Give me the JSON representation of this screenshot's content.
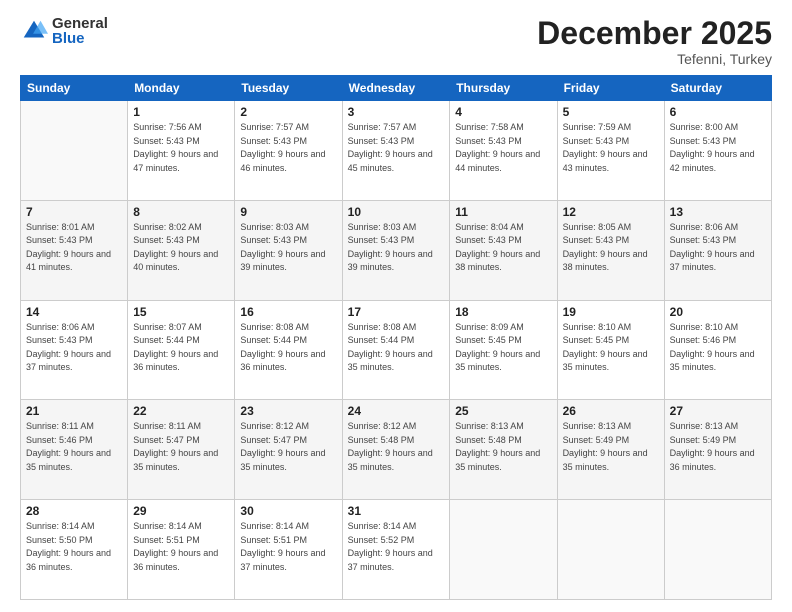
{
  "logo": {
    "general": "General",
    "blue": "Blue"
  },
  "header": {
    "month": "December 2025",
    "location": "Tefenni, Turkey"
  },
  "days_of_week": [
    "Sunday",
    "Monday",
    "Tuesday",
    "Wednesday",
    "Thursday",
    "Friday",
    "Saturday"
  ],
  "weeks": [
    [
      {
        "day": "",
        "sunrise": "",
        "sunset": "",
        "daylight": ""
      },
      {
        "day": "1",
        "sunrise": "Sunrise: 7:56 AM",
        "sunset": "Sunset: 5:43 PM",
        "daylight": "Daylight: 9 hours and 47 minutes."
      },
      {
        "day": "2",
        "sunrise": "Sunrise: 7:57 AM",
        "sunset": "Sunset: 5:43 PM",
        "daylight": "Daylight: 9 hours and 46 minutes."
      },
      {
        "day": "3",
        "sunrise": "Sunrise: 7:57 AM",
        "sunset": "Sunset: 5:43 PM",
        "daylight": "Daylight: 9 hours and 45 minutes."
      },
      {
        "day": "4",
        "sunrise": "Sunrise: 7:58 AM",
        "sunset": "Sunset: 5:43 PM",
        "daylight": "Daylight: 9 hours and 44 minutes."
      },
      {
        "day": "5",
        "sunrise": "Sunrise: 7:59 AM",
        "sunset": "Sunset: 5:43 PM",
        "daylight": "Daylight: 9 hours and 43 minutes."
      },
      {
        "day": "6",
        "sunrise": "Sunrise: 8:00 AM",
        "sunset": "Sunset: 5:43 PM",
        "daylight": "Daylight: 9 hours and 42 minutes."
      }
    ],
    [
      {
        "day": "7",
        "sunrise": "Sunrise: 8:01 AM",
        "sunset": "Sunset: 5:43 PM",
        "daylight": "Daylight: 9 hours and 41 minutes."
      },
      {
        "day": "8",
        "sunrise": "Sunrise: 8:02 AM",
        "sunset": "Sunset: 5:43 PM",
        "daylight": "Daylight: 9 hours and 40 minutes."
      },
      {
        "day": "9",
        "sunrise": "Sunrise: 8:03 AM",
        "sunset": "Sunset: 5:43 PM",
        "daylight": "Daylight: 9 hours and 39 minutes."
      },
      {
        "day": "10",
        "sunrise": "Sunrise: 8:03 AM",
        "sunset": "Sunset: 5:43 PM",
        "daylight": "Daylight: 9 hours and 39 minutes."
      },
      {
        "day": "11",
        "sunrise": "Sunrise: 8:04 AM",
        "sunset": "Sunset: 5:43 PM",
        "daylight": "Daylight: 9 hours and 38 minutes."
      },
      {
        "day": "12",
        "sunrise": "Sunrise: 8:05 AM",
        "sunset": "Sunset: 5:43 PM",
        "daylight": "Daylight: 9 hours and 38 minutes."
      },
      {
        "day": "13",
        "sunrise": "Sunrise: 8:06 AM",
        "sunset": "Sunset: 5:43 PM",
        "daylight": "Daylight: 9 hours and 37 minutes."
      }
    ],
    [
      {
        "day": "14",
        "sunrise": "Sunrise: 8:06 AM",
        "sunset": "Sunset: 5:43 PM",
        "daylight": "Daylight: 9 hours and 37 minutes."
      },
      {
        "day": "15",
        "sunrise": "Sunrise: 8:07 AM",
        "sunset": "Sunset: 5:44 PM",
        "daylight": "Daylight: 9 hours and 36 minutes."
      },
      {
        "day": "16",
        "sunrise": "Sunrise: 8:08 AM",
        "sunset": "Sunset: 5:44 PM",
        "daylight": "Daylight: 9 hours and 36 minutes."
      },
      {
        "day": "17",
        "sunrise": "Sunrise: 8:08 AM",
        "sunset": "Sunset: 5:44 PM",
        "daylight": "Daylight: 9 hours and 35 minutes."
      },
      {
        "day": "18",
        "sunrise": "Sunrise: 8:09 AM",
        "sunset": "Sunset: 5:45 PM",
        "daylight": "Daylight: 9 hours and 35 minutes."
      },
      {
        "day": "19",
        "sunrise": "Sunrise: 8:10 AM",
        "sunset": "Sunset: 5:45 PM",
        "daylight": "Daylight: 9 hours and 35 minutes."
      },
      {
        "day": "20",
        "sunrise": "Sunrise: 8:10 AM",
        "sunset": "Sunset: 5:46 PM",
        "daylight": "Daylight: 9 hours and 35 minutes."
      }
    ],
    [
      {
        "day": "21",
        "sunrise": "Sunrise: 8:11 AM",
        "sunset": "Sunset: 5:46 PM",
        "daylight": "Daylight: 9 hours and 35 minutes."
      },
      {
        "day": "22",
        "sunrise": "Sunrise: 8:11 AM",
        "sunset": "Sunset: 5:47 PM",
        "daylight": "Daylight: 9 hours and 35 minutes."
      },
      {
        "day": "23",
        "sunrise": "Sunrise: 8:12 AM",
        "sunset": "Sunset: 5:47 PM",
        "daylight": "Daylight: 9 hours and 35 minutes."
      },
      {
        "day": "24",
        "sunrise": "Sunrise: 8:12 AM",
        "sunset": "Sunset: 5:48 PM",
        "daylight": "Daylight: 9 hours and 35 minutes."
      },
      {
        "day": "25",
        "sunrise": "Sunrise: 8:13 AM",
        "sunset": "Sunset: 5:48 PM",
        "daylight": "Daylight: 9 hours and 35 minutes."
      },
      {
        "day": "26",
        "sunrise": "Sunrise: 8:13 AM",
        "sunset": "Sunset: 5:49 PM",
        "daylight": "Daylight: 9 hours and 35 minutes."
      },
      {
        "day": "27",
        "sunrise": "Sunrise: 8:13 AM",
        "sunset": "Sunset: 5:49 PM",
        "daylight": "Daylight: 9 hours and 36 minutes."
      }
    ],
    [
      {
        "day": "28",
        "sunrise": "Sunrise: 8:14 AM",
        "sunset": "Sunset: 5:50 PM",
        "daylight": "Daylight: 9 hours and 36 minutes."
      },
      {
        "day": "29",
        "sunrise": "Sunrise: 8:14 AM",
        "sunset": "Sunset: 5:51 PM",
        "daylight": "Daylight: 9 hours and 36 minutes."
      },
      {
        "day": "30",
        "sunrise": "Sunrise: 8:14 AM",
        "sunset": "Sunset: 5:51 PM",
        "daylight": "Daylight: 9 hours and 37 minutes."
      },
      {
        "day": "31",
        "sunrise": "Sunrise: 8:14 AM",
        "sunset": "Sunset: 5:52 PM",
        "daylight": "Daylight: 9 hours and 37 minutes."
      },
      {
        "day": "",
        "sunrise": "",
        "sunset": "",
        "daylight": ""
      },
      {
        "day": "",
        "sunrise": "",
        "sunset": "",
        "daylight": ""
      },
      {
        "day": "",
        "sunrise": "",
        "sunset": "",
        "daylight": ""
      }
    ]
  ]
}
